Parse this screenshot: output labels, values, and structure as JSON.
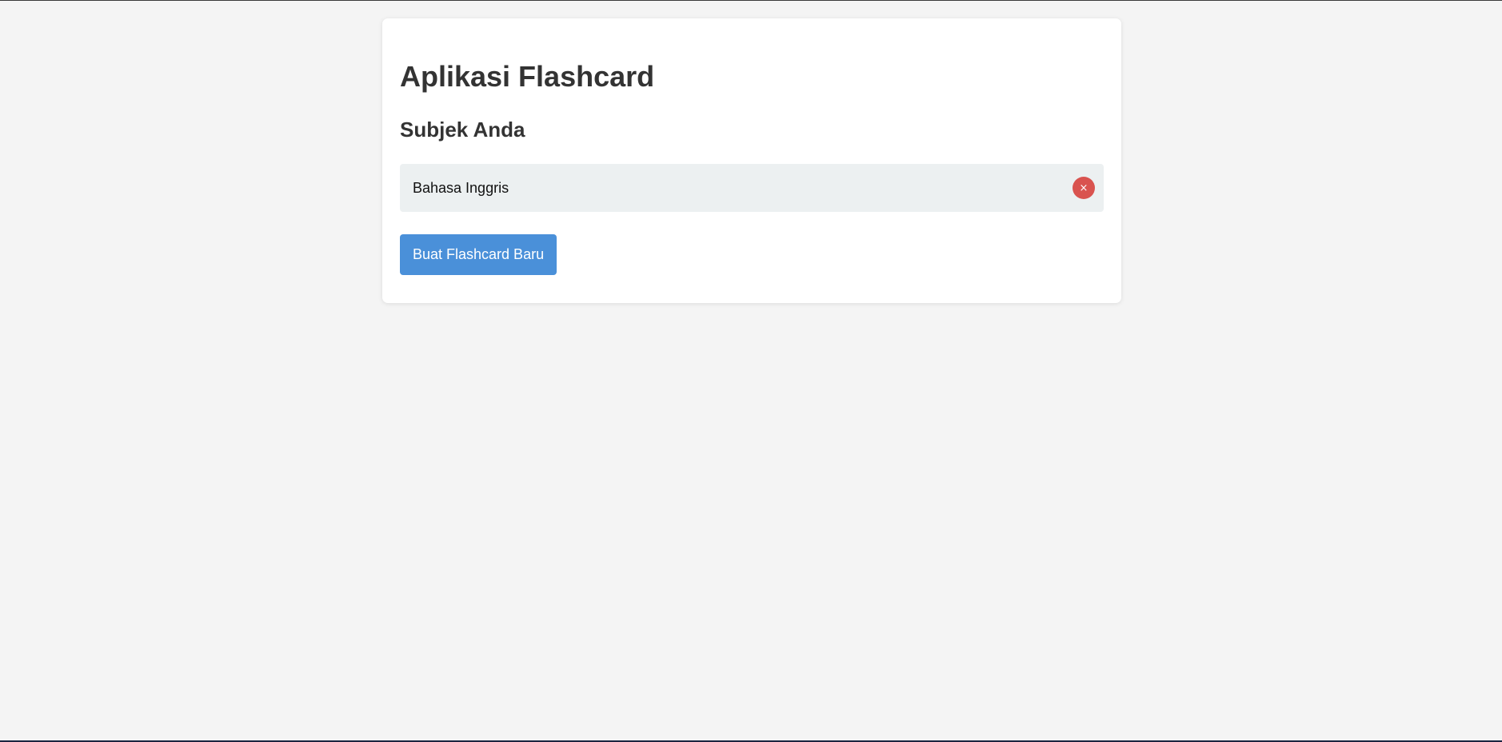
{
  "app": {
    "title": "Aplikasi Flashcard"
  },
  "subjects": {
    "heading": "Subjek Anda",
    "items": [
      {
        "label": "Bahasa Inggris",
        "delete_symbol": "×"
      }
    ]
  },
  "actions": {
    "create_label": "Buat Flashcard Baru"
  },
  "colors": {
    "background": "#f4f4f4",
    "card": "#ffffff",
    "item_background": "#ecf0f1",
    "delete": "#d9534f",
    "primary": "#4a90d9",
    "text": "#333333"
  }
}
